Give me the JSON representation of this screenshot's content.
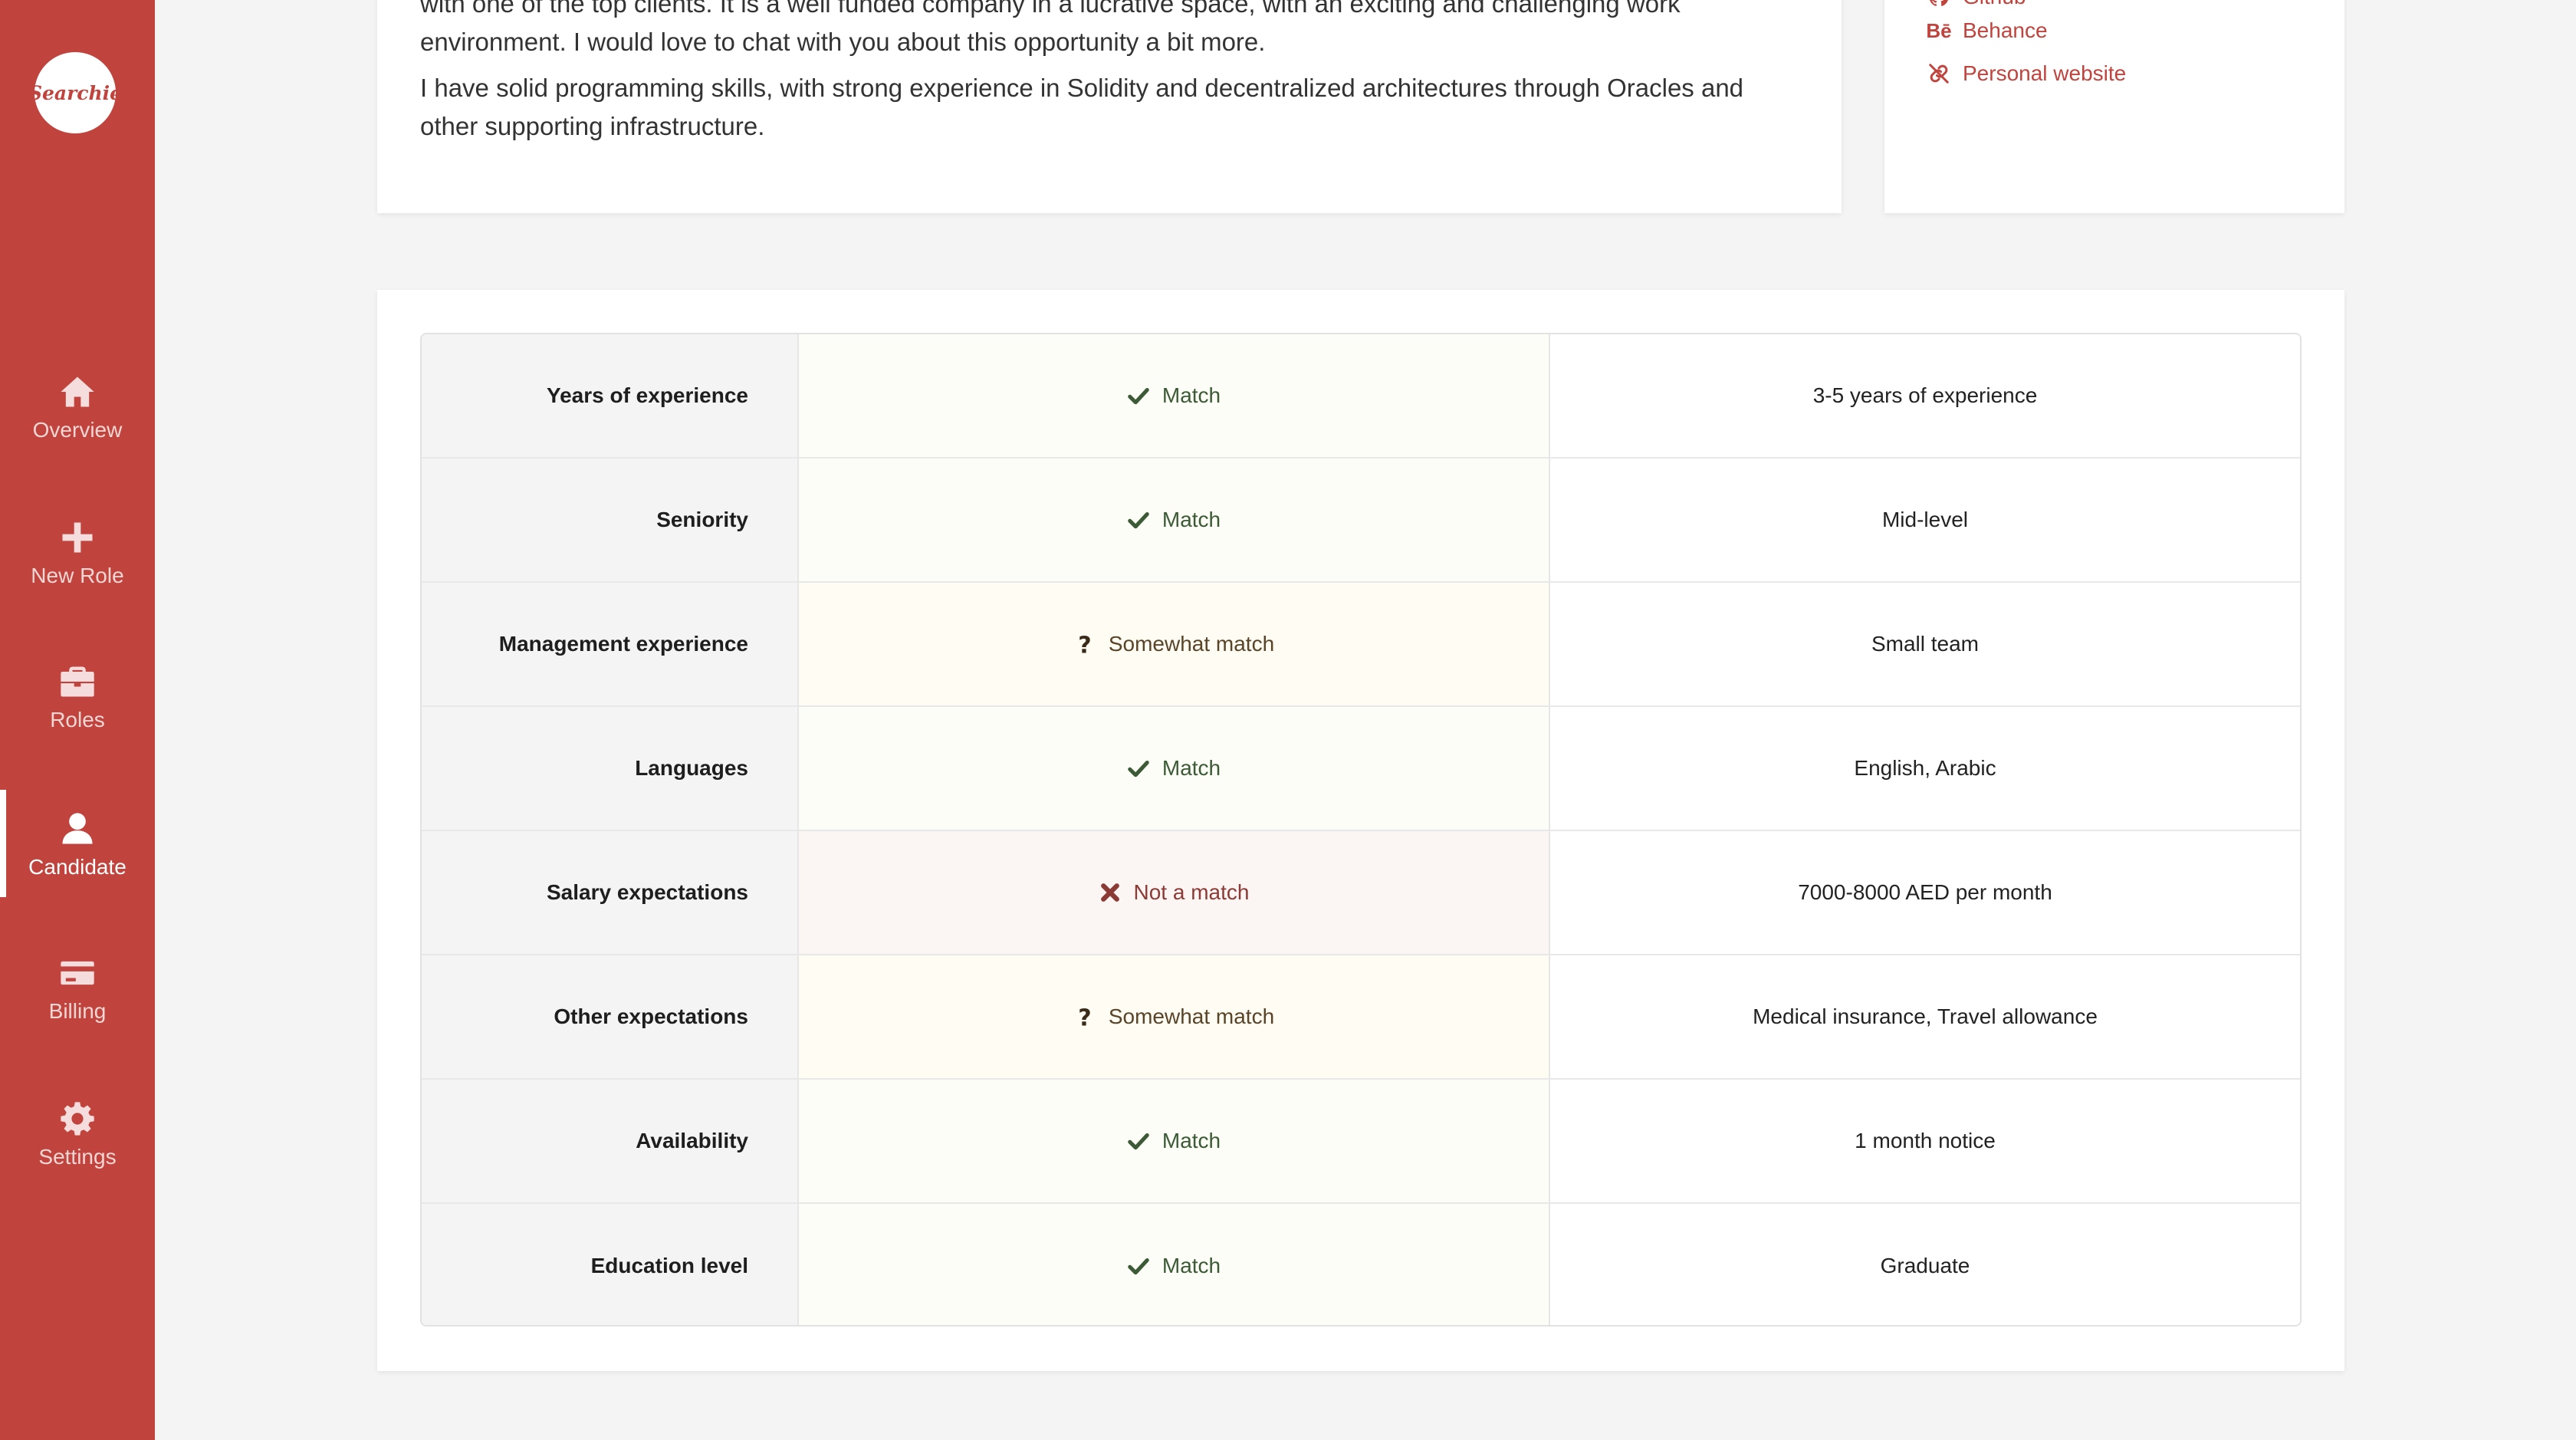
{
  "app": {
    "logo_text": "Searchie"
  },
  "sidebar": {
    "items": [
      {
        "label": "Overview",
        "icon": "home-icon",
        "active": false
      },
      {
        "label": "New Role",
        "icon": "plus-icon",
        "active": false
      },
      {
        "label": "Roles",
        "icon": "briefcase-icon",
        "active": false
      },
      {
        "label": "Candidate",
        "icon": "user-icon",
        "active": true
      },
      {
        "label": "Billing",
        "icon": "credit-card-icon",
        "active": false
      },
      {
        "label": "Settings",
        "icon": "gear-icon",
        "active": false
      }
    ]
  },
  "about": {
    "paragraph1": "with one of the top clients. It is a well funded company in a lucrative space, with an exciting and challenging work environment. I would love to chat with you about this opportunity a bit more.",
    "paragraph2": "I have solid programming skills, with strong experience in Solidity and decentralized architectures through Oracles and other supporting infrastructure."
  },
  "links": {
    "items": [
      {
        "label": "Github",
        "icon": "github-icon"
      },
      {
        "label": "Behance",
        "icon": "behance-icon"
      },
      {
        "label": "Personal website",
        "icon": "broken-link-icon"
      }
    ]
  },
  "colors": {
    "brand": "#c0443d",
    "match": "#3c5a35",
    "somewhat": "#5a4428",
    "not_match": "#8c3a35"
  },
  "match_table": {
    "rows": [
      {
        "label": "Years of experience",
        "status": "Match",
        "status_type": "match",
        "value": "3-5 years of experience"
      },
      {
        "label": "Seniority",
        "status": "Match",
        "status_type": "match",
        "value": "Mid-level"
      },
      {
        "label": "Management experience",
        "status": "Somewhat match",
        "status_type": "some",
        "value": "Small team"
      },
      {
        "label": "Languages",
        "status": "Match",
        "status_type": "match",
        "value": "English, Arabic"
      },
      {
        "label": "Salary expectations",
        "status": "Not a match",
        "status_type": "none",
        "value": "7000-8000 AED per month"
      },
      {
        "label": "Other expectations",
        "status": "Somewhat match",
        "status_type": "some",
        "value": "Medical insurance, Travel allowance"
      },
      {
        "label": "Availability",
        "status": "Match",
        "status_type": "match",
        "value": "1 month notice"
      },
      {
        "label": "Education level",
        "status": "Match",
        "status_type": "match",
        "value": "Graduate"
      }
    ]
  }
}
